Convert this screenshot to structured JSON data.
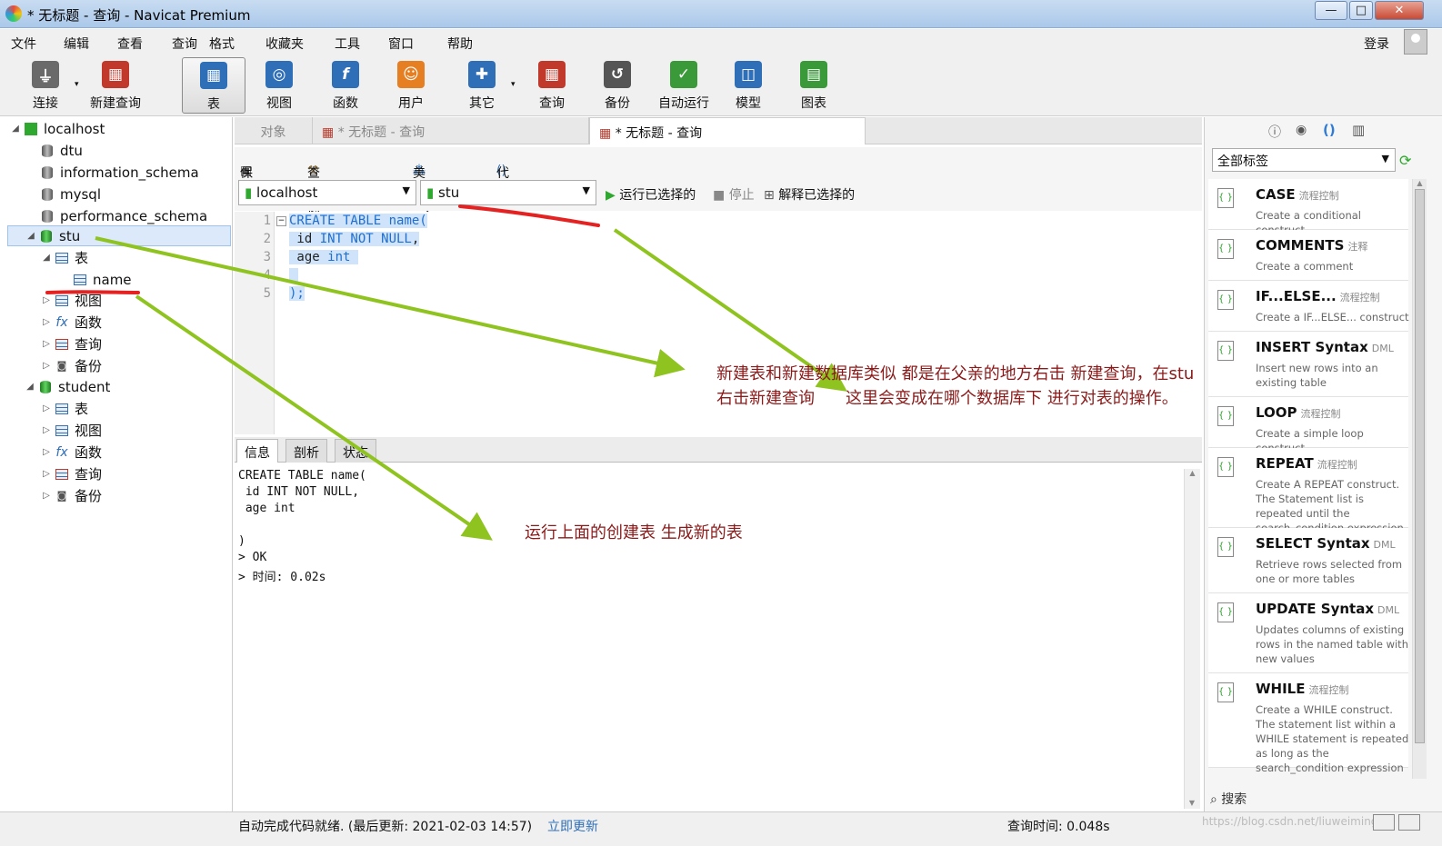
{
  "window": {
    "title": "* 无标题 - 查询 - Navicat Premium",
    "min": "—",
    "max": "□",
    "close": "✕"
  },
  "menu": [
    "文件",
    "编辑",
    "查看",
    "查询",
    "格式",
    "收藏夹",
    "工具",
    "窗口",
    "帮助"
  ],
  "login": "登录",
  "toolbar": [
    {
      "label": "连接",
      "icon": "plug-icon",
      "color": "#6a6a6a"
    },
    {
      "label": "新建查询",
      "icon": "new-query-icon",
      "color": "#c0392b"
    },
    {
      "label": "表",
      "icon": "table-icon",
      "color": "#2f6fb7"
    },
    {
      "label": "视图",
      "icon": "view-icon",
      "color": "#2f6fb7"
    },
    {
      "label": "函数",
      "icon": "function-icon",
      "color": "#2f6fb7"
    },
    {
      "label": "用户",
      "icon": "user-icon",
      "color": "#e67e22"
    },
    {
      "label": "其它",
      "icon": "tools-icon",
      "color": "#2f6fb7"
    },
    {
      "label": "查询",
      "icon": "query-icon",
      "color": "#c0392b"
    },
    {
      "label": "备份",
      "icon": "backup-icon",
      "color": "#555555"
    },
    {
      "label": "自动运行",
      "icon": "schedule-icon",
      "color": "#3a9a3a"
    },
    {
      "label": "模型",
      "icon": "model-icon",
      "color": "#2f6fb7"
    },
    {
      "label": "图表",
      "icon": "chart-icon",
      "color": "#3a9a3a"
    }
  ],
  "tree": [
    {
      "label": "localhost",
      "kind": "conn",
      "level": 0,
      "tri": "◢"
    },
    {
      "label": "dtu",
      "kind": "db",
      "level": 1,
      "tri": ""
    },
    {
      "label": "information_schema",
      "kind": "db",
      "level": 1,
      "tri": ""
    },
    {
      "label": "mysql",
      "kind": "db",
      "level": 1,
      "tri": ""
    },
    {
      "label": "performance_schema",
      "kind": "db",
      "level": 1,
      "tri": ""
    },
    {
      "label": "stu",
      "kind": "dbg",
      "level": 1,
      "tri": "◢",
      "selected": true
    },
    {
      "label": "表",
      "kind": "table",
      "level": 2,
      "tri": "◢"
    },
    {
      "label": "name",
      "kind": "table",
      "level": 3,
      "tri": ""
    },
    {
      "label": "视图",
      "kind": "view",
      "level": 2,
      "tri": "▷"
    },
    {
      "label": "函数",
      "kind": "func",
      "level": 2,
      "tri": "▷"
    },
    {
      "label": "查询",
      "kind": "query",
      "level": 2,
      "tri": "▷"
    },
    {
      "label": "备份",
      "kind": "backup",
      "level": 2,
      "tri": "▷"
    },
    {
      "label": "student",
      "kind": "dbg",
      "level": 1,
      "tri": "◢"
    },
    {
      "label": "表",
      "kind": "table",
      "level": 2,
      "tri": "▷"
    },
    {
      "label": "视图",
      "kind": "view",
      "level": 2,
      "tri": "▷"
    },
    {
      "label": "函数",
      "kind": "func",
      "level": 2,
      "tri": "▷"
    },
    {
      "label": "查询",
      "kind": "query",
      "level": 2,
      "tri": "▷"
    },
    {
      "label": "备份",
      "kind": "backup",
      "level": 2,
      "tri": "▷"
    }
  ],
  "tabs": {
    "objects": "对象",
    "tab1": "* 无标题 - 查询",
    "tab2": "* 无标题 - 查询"
  },
  "querytools": {
    "save": "保存",
    "builder": "查询创建工具",
    "beautify": "美化 SQL",
    "snippet": "代码段"
  },
  "connection": {
    "server": "localhost",
    "database": "stu",
    "run": "运行已选择的",
    "stop": "停止",
    "explain": "解释已选择的"
  },
  "code": {
    "line_numbers": [
      "1",
      "2",
      "3",
      "4",
      "5"
    ],
    "lines": [
      {
        "pre": "",
        "kw": "CREATE TABLE",
        "post": " name("
      },
      {
        "pre": " id ",
        "kw": "INT NOT NULL",
        "post": ","
      },
      {
        "pre": " age ",
        "kw": "int",
        "post": ""
      },
      {
        "pre": "",
        "kw": "",
        "post": ""
      },
      {
        "pre": ");",
        "kw": "",
        "post": ""
      }
    ]
  },
  "result_tabs": [
    "信息",
    "剖析",
    "状态"
  ],
  "result_lines": [
    "CREATE TABLE name(",
    " id INT NOT NULL,",
    " age int",
    "",
    ")",
    "> OK",
    "> 时间: 0.02s"
  ],
  "rpanel": {
    "filter": "全部标签",
    "search": "搜索"
  },
  "snippets": [
    {
      "title": "CASE",
      "tag": "流程控制",
      "desc": "Create a conditional construct"
    },
    {
      "title": "COMMENTS",
      "tag": "注释",
      "desc": "Create a comment"
    },
    {
      "title": "IF...ELSE...",
      "tag": "流程控制",
      "desc": "Create a IF...ELSE... construct"
    },
    {
      "title": "INSERT Syntax",
      "tag": "DML",
      "desc": "Insert new rows into an existing table"
    },
    {
      "title": "LOOP",
      "tag": "流程控制",
      "desc": "Create a simple loop construct"
    },
    {
      "title": "REPEAT",
      "tag": "流程控制",
      "desc": "Create A REPEAT construct. The Statement list is repeated until the search_condition expression is true."
    },
    {
      "title": "SELECT Syntax",
      "tag": "DML",
      "desc": "Retrieve rows selected from one or more tables"
    },
    {
      "title": "UPDATE Syntax",
      "tag": "DML",
      "desc": "Updates columns of existing rows in the named table with new values"
    },
    {
      "title": "WHILE",
      "tag": "流程控制",
      "desc": "Create a WHILE construct. The statement list within a WHILE statement is repeated as long as the search_condition expression"
    }
  ],
  "status": {
    "autocomplete": "自动完成代码就绪. (最后更新: 2021-02-03 14:57)",
    "update": "立即更新",
    "querytime": "查询时间: 0.048s",
    "watermark": "https://blog.csdn.net/liuweiming"
  },
  "annotations": {
    "a1_line1": "新建表和新建数据库类似 都是在父亲的地方右击 新建查询，在stu",
    "a1_line2": "右击新建查询",
    "a2": "这里会变成在哪个数据库下 进行对表的操作。",
    "a3": "运行上面的创建表 生成新的表"
  }
}
